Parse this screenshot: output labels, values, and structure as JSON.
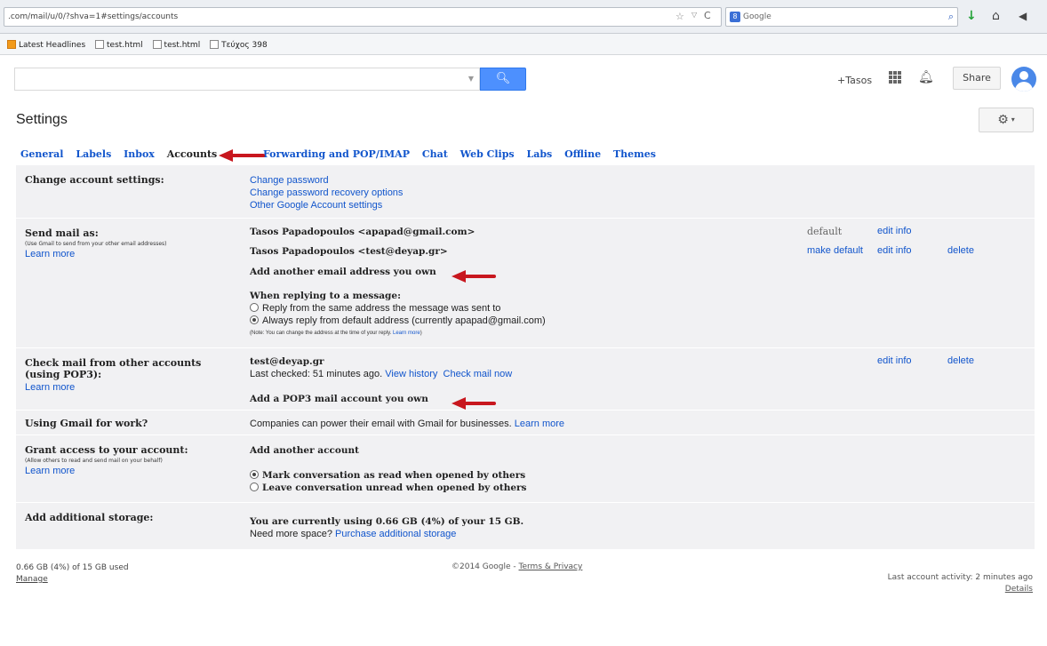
{
  "browser": {
    "url": ".com/mail/u/0/?shva=1#settings/accounts",
    "search_engine": "Google",
    "bookmarks": [
      "Latest Headlines",
      "test.html",
      "test.html",
      "Τεύχος 398"
    ]
  },
  "header": {
    "plus_user": "+Tasos",
    "share_label": "Share",
    "page_title": "Settings"
  },
  "tabs": [
    {
      "label": "General"
    },
    {
      "label": "Labels"
    },
    {
      "label": "Inbox"
    },
    {
      "label": "Accounts"
    },
    {
      "label": "Forwarding and POP/IMAP"
    },
    {
      "label": "Chat"
    },
    {
      "label": "Web Clips"
    },
    {
      "label": "Labs"
    },
    {
      "label": "Offline"
    },
    {
      "label": "Themes"
    }
  ],
  "sections": {
    "change_account": {
      "label": "Change account settings:",
      "links": [
        "Change password",
        "Change password recovery options",
        "Other Google Account settings"
      ]
    },
    "send_mail": {
      "label": "Send mail as:",
      "sub": "(Use Gmail to send from your other email addresses)",
      "learn_more": "Learn more",
      "addr1": "Tasos Papadopoulos <apapad@gmail.com>",
      "addr1_status": "default",
      "addr2": "Tasos Papadopoulos <test@deyap.gr>",
      "make_default": "make default",
      "edit_info": "edit info",
      "delete": "delete",
      "add_link": "Add another email address you own",
      "reply_heading": "When replying to a message:",
      "reply_opt1": "Reply from the same address the message was sent to",
      "reply_opt2": "Always reply from default address (currently apapad@gmail.com)",
      "reply_note": "(Note: You can change the address at the time of your reply.",
      "reply_note_link": "Learn more"
    },
    "check_mail": {
      "label": "Check mail from other accounts (using POP3):",
      "learn_more": "Learn more",
      "account": "test@deyap.gr",
      "last_checked": "Last checked: 51 minutes ago.",
      "view_history": "View history",
      "check_now": "Check mail now",
      "edit_info": "edit info",
      "delete": "delete",
      "add_link": "Add a POP3 mail account you own"
    },
    "work": {
      "label": "Using Gmail for work?",
      "text": "Companies can power their email with Gmail for businesses.",
      "learn_more": "Learn more"
    },
    "grant": {
      "label": "Grant access to your account:",
      "sub": "(Allow others to read and send mail on your behalf)",
      "learn_more": "Learn more",
      "add_link": "Add another account",
      "opt1": "Mark conversation as read when opened by others",
      "opt2": "Leave conversation unread when opened by others"
    },
    "storage": {
      "label": "Add additional storage:",
      "usage": "You are currently using 0.66 GB (4%) of your 15 GB.",
      "need_more": "Need more space?",
      "purchase": "Purchase additional storage"
    }
  },
  "footer": {
    "usage": "0.66 GB (4%) of 15 GB used",
    "manage": "Manage",
    "copyright": "©2014 Google -",
    "terms": "Terms & Privacy",
    "last_activity": "Last account activity: 2 minutes ago",
    "details": "Details"
  },
  "colors": {
    "link": "#1155cc",
    "accent_blue": "#4d90fe",
    "annotation_red": "#c8171e",
    "panel_bg": "#f1f1f3"
  }
}
